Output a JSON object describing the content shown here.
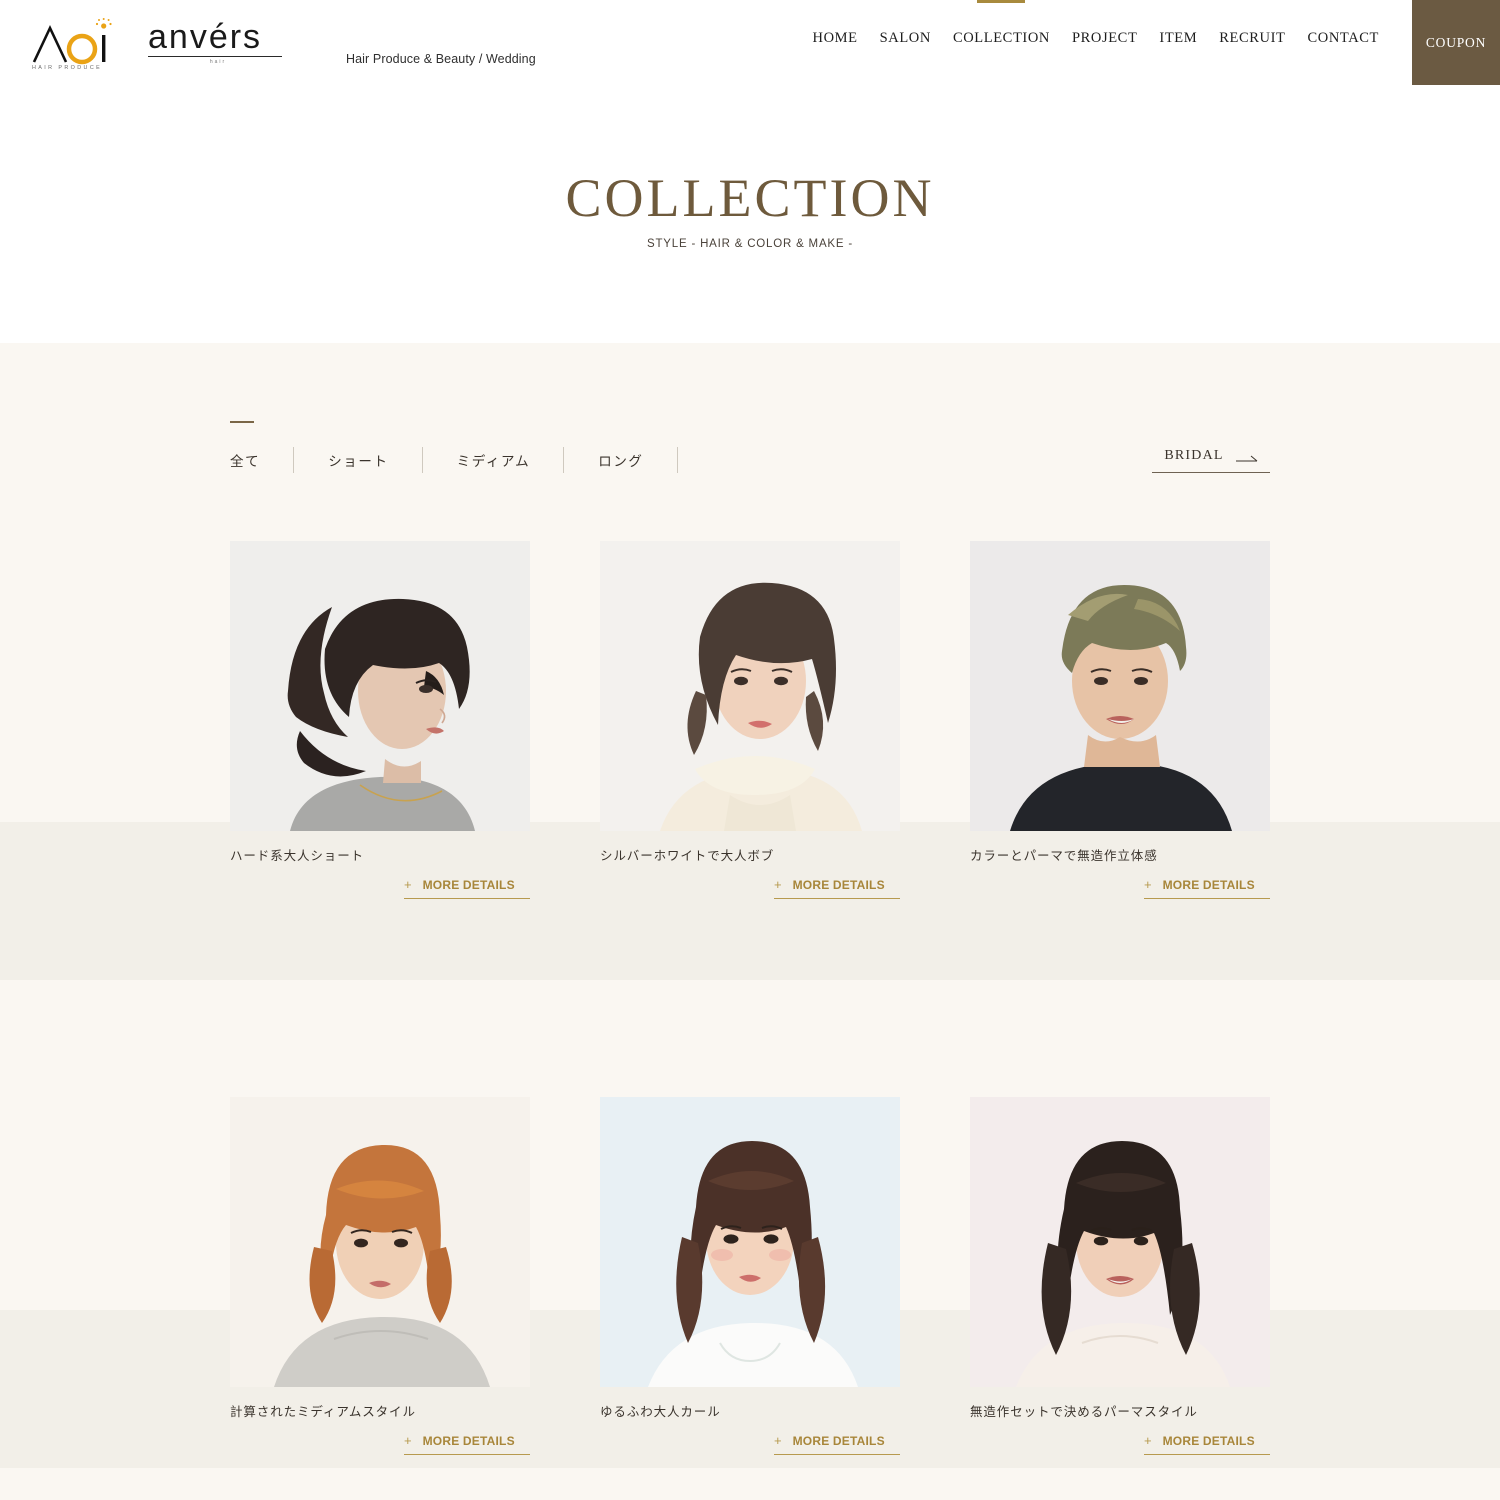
{
  "header": {
    "brand": {
      "logo_primary": "AOI",
      "logo_primary_sub": "HAIR PRODUCE",
      "logo_secondary": "anvérs",
      "logo_secondary_sub": "hair",
      "tagline": "Hair Produce & Beauty / Wedding"
    },
    "nav": [
      {
        "label": "HOME",
        "active": false
      },
      {
        "label": "SALON",
        "active": false
      },
      {
        "label": "COLLECTION",
        "active": true
      },
      {
        "label": "PROJECT",
        "active": false
      },
      {
        "label": "ITEM",
        "active": false
      },
      {
        "label": "RECRUIT",
        "active": false
      },
      {
        "label": "CONTACT",
        "active": false
      }
    ],
    "coupon_label": "COUPON",
    "title": "COLLECTION",
    "subtitle": "STYLE  - HAIR & COLOR & MAKE -"
  },
  "filters": {
    "tabs": [
      {
        "label": "全て",
        "active": true
      },
      {
        "label": "ショート",
        "active": false
      },
      {
        "label": "ミディアム",
        "active": false
      },
      {
        "label": "ロング",
        "active": false
      }
    ],
    "bridal_label": "BRIDAL",
    "bridal_arrow_icon": "arrow-right-icon"
  },
  "gallery": {
    "more_label": "MORE DETAILS",
    "more_plus": "+",
    "items": [
      {
        "title": "ハード系大人ショート",
        "image": "short-dark-wavy-woman"
      },
      {
        "title": "シルバーホワイトで大人ボブ",
        "image": "silver-white-bob-woman"
      },
      {
        "title": "カラーとパーマで無造作立体感",
        "image": "ash-blonde-perm-man"
      },
      {
        "title": "計算されたミディアムスタイル",
        "image": "orange-medium-woman"
      },
      {
        "title": "ゆるふわ大人カール",
        "image": "soft-curl-woman"
      },
      {
        "title": "無造作セットで決めるパーマスタイル",
        "image": "perm-style-woman"
      }
    ]
  },
  "colors": {
    "accent_gold": "#a8863a",
    "brand_brown": "#6b5a42",
    "title_brown": "#6e5a3c",
    "page_bg": "#faf7f2",
    "band_bg": "#f2efe8"
  }
}
